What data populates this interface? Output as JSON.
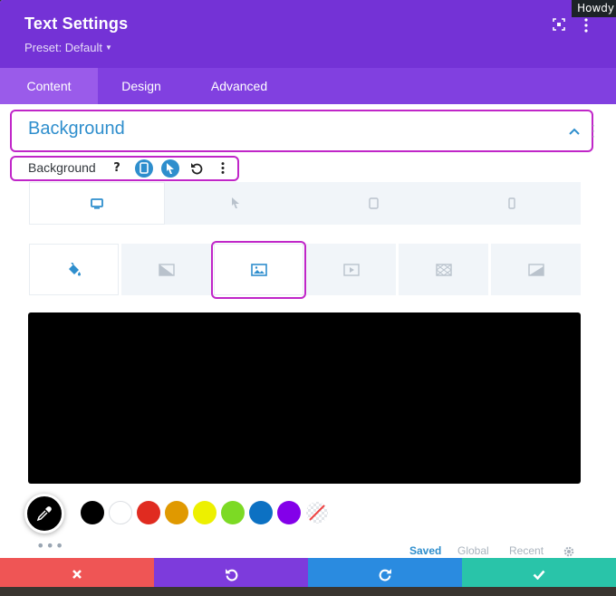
{
  "topbar": {
    "greeting": "Howdy"
  },
  "header": {
    "title": "Text Settings",
    "preset": "Preset: Default"
  },
  "tabs": [
    {
      "label": "Content",
      "active": true
    },
    {
      "label": "Design",
      "active": false
    },
    {
      "label": "Advanced",
      "active": false
    }
  ],
  "section": {
    "title": "Background",
    "expanded": true
  },
  "option": {
    "label": "Background",
    "help": "?"
  },
  "device_tabs": [
    "desktop-icon",
    "hover-pointer-icon",
    "tablet-icon",
    "phone-icon"
  ],
  "background_tabs": [
    "color-icon",
    "gradient-icon",
    "image-icon",
    "video-icon",
    "pattern-icon",
    "mask-icon"
  ],
  "preview": {
    "color": "#000000"
  },
  "swatches": [
    "#000000",
    "#ffffff",
    "#e02b20",
    "#e09900",
    "#edf000",
    "#7cda24",
    "#0c71c3",
    "#8300e9",
    "none"
  ],
  "palette_tabs": {
    "saved": "Saved",
    "global": "Global",
    "recent": "Recent"
  },
  "colors": {
    "header": "#7432d6",
    "tabs": "#8140e0",
    "accent": "#2e8ecd",
    "highlight": "#c026c8"
  }
}
